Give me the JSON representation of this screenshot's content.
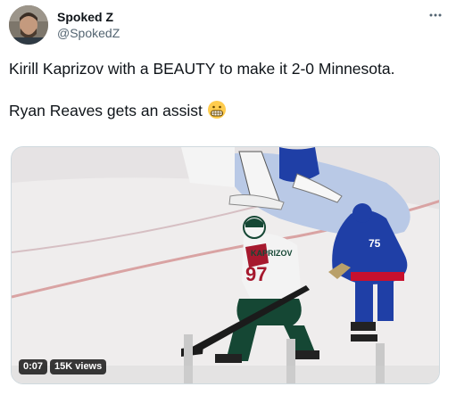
{
  "tweet": {
    "author": {
      "display_name": "Spoked Z",
      "handle": "@SpokedZ",
      "avatar_icon": "avatar-photo"
    },
    "more_icon": "more-icon",
    "text_line_1": "Kirill Kaprizov with a BEAUTY to make it 2-0 Minnesota.",
    "text_line_2": "Ryan Reaves gets an assist",
    "emoji": "grimacing-face-emoji"
  },
  "media": {
    "type": "video",
    "duration": "0:07",
    "views": "15K views",
    "jersey_name": "KAPRIZOV",
    "jersey_number": "97",
    "opponent_number": "75"
  },
  "colors": {
    "handle_gray": "#536471",
    "wild_green": "#154734",
    "wild_red": "#a6192e",
    "rangers_blue": "#1f3fa6",
    "rangers_red": "#c8102e"
  }
}
